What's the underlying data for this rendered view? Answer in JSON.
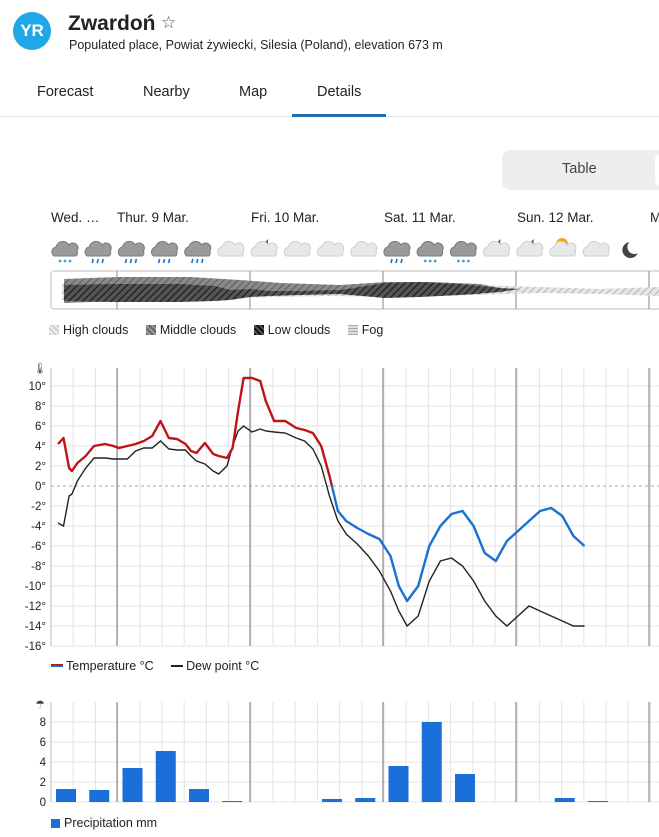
{
  "header": {
    "logo_text": "YR",
    "title": "Zwardoń",
    "star": "☆",
    "subtitle": "Populated place, Powiat żywiecki, Silesia (Poland), elevation 673 m"
  },
  "tabs": [
    {
      "label": "Forecast"
    },
    {
      "label": "Nearby"
    },
    {
      "label": "Map"
    },
    {
      "label": "Details",
      "active": true
    }
  ],
  "view_toggle": {
    "label": "Table"
  },
  "days": [
    "Wed. …",
    "Thur. 9 Mar.",
    "Fri. 10 Mar.",
    "Sat. 11 Mar.",
    "Sun. 12 Mar.",
    "M"
  ],
  "weather_icons": [
    "snow-cloud-icon",
    "rain-cloud-icon",
    "rain-cloud-icon",
    "rain-cloud-icon",
    "rain-cloud-icon",
    "cloud-icon",
    "moon-cloud-icon",
    "cloud-icon",
    "cloud-icon",
    "cloud-icon",
    "rain-cloud-icon",
    "snow-cloud-icon",
    "snow-cloud-icon",
    "moon-cloud-icon",
    "moon-cloud-icon",
    "sun-cloud-icon",
    "cloud-icon",
    "moon-icon"
  ],
  "cloud_legend": {
    "high": "High clouds",
    "middle": "Middle clouds",
    "low": "Low clouds",
    "fog": "Fog"
  },
  "temp_legend": {
    "temperature": "Temperature °C",
    "dew_point": "Dew point °C"
  },
  "precip_legend": {
    "label": "Precipitation mm"
  },
  "colors": {
    "temp_warm": "#c0141a",
    "temp_cold": "#1a72d0",
    "dew": "#222222",
    "precip": "#1a6fd8",
    "accent": "#1f6fb5",
    "logo": "#1fa7e6"
  },
  "chart_data": [
    {
      "type": "line",
      "title": "",
      "ylabel": "°C",
      "ylim": [
        -16,
        11
      ],
      "yticks": [
        "10°",
        "8°",
        "6°",
        "4°",
        "2°",
        "0°",
        "-2°",
        "-4°",
        "-6°",
        "-8°",
        "-10°",
        "-12°",
        "-14°",
        "-16°"
      ],
      "x_unit": "hours from start of chart",
      "series": [
        {
          "name": "Temperature °C",
          "x": [
            0,
            2,
            4,
            5,
            7,
            10,
            13,
            17,
            20,
            22,
            25,
            28,
            31,
            34,
            37,
            40,
            43,
            46,
            48,
            50,
            53,
            56,
            58,
            61,
            63,
            65,
            67,
            70,
            73,
            75,
            78,
            82,
            86,
            89,
            92,
            95,
            98,
            101,
            104,
            108,
            112,
            116,
            120,
            123,
            126,
            130,
            134,
            138,
            142,
            146,
            150,
            154,
            158,
            162,
            166,
            170,
            174,
            178,
            182,
            186,
            190
          ],
          "y": [
            4.2,
            4.8,
            1.8,
            1.5,
            2.3,
            3.0,
            4.0,
            4.2,
            4.0,
            3.8,
            4.0,
            4.2,
            4.5,
            5.0,
            6.5,
            4.8,
            4.7,
            4.2,
            3.5,
            3.3,
            4.3,
            3.2,
            3.0,
            2.8,
            3.8,
            7.5,
            10.8,
            10.8,
            10.5,
            8.5,
            6.5,
            6.5,
            5.8,
            5.6,
            5.3,
            4.0,
            1.0,
            -2.5,
            -3.5,
            -4.2,
            -4.8,
            -5.3,
            -7.0,
            -10.0,
            -11.5,
            -10.0,
            -6.0,
            -4.0,
            -2.8,
            -2.5,
            -4.0,
            -6.7,
            -7.5,
            -5.5,
            -4.5,
            -3.5,
            -2.5,
            -2.2,
            -3.0,
            -5.0,
            -6.0
          ]
        },
        {
          "name": "Dew point °C",
          "x": [
            0,
            2,
            4,
            5,
            7,
            10,
            13,
            17,
            20,
            22,
            25,
            28,
            31,
            34,
            37,
            40,
            43,
            46,
            48,
            50,
            53,
            56,
            58,
            61,
            63,
            65,
            67,
            70,
            73,
            75,
            78,
            82,
            86,
            89,
            92,
            95,
            98,
            101,
            104,
            108,
            112,
            116,
            120,
            123,
            126,
            130,
            134,
            138,
            142,
            146,
            150,
            154,
            158,
            162,
            166,
            170,
            174,
            178,
            182,
            186,
            190
          ],
          "y": [
            -3.7,
            -4.0,
            -1.0,
            -0.8,
            0.5,
            1.8,
            2.8,
            2.8,
            2.7,
            2.7,
            2.7,
            3.5,
            3.8,
            3.8,
            4.5,
            3.7,
            3.6,
            3.6,
            3.0,
            2.5,
            2.2,
            1.5,
            1.2,
            2.0,
            4.0,
            5.5,
            6.0,
            5.4,
            5.7,
            5.5,
            5.4,
            5.3,
            4.8,
            4.5,
            3.7,
            2.0,
            -1.0,
            -3.5,
            -4.8,
            -5.8,
            -7.0,
            -8.5,
            -10.5,
            -12.5,
            -14.0,
            -13.0,
            -9.5,
            -7.5,
            -7.2,
            -8.0,
            -9.5,
            -11.5,
            -13.0,
            -14.0,
            -13.0,
            -12.0,
            -12.5,
            -13.0,
            -13.5,
            -14.0,
            -14.0
          ]
        }
      ],
      "grid": true
    },
    {
      "type": "bar",
      "title": "",
      "ylabel": "mm",
      "ylim": [
        0,
        9
      ],
      "yticks": [
        "8",
        "6",
        "4",
        "2",
        "0"
      ],
      "categories": [
        "1",
        "2",
        "3",
        "4",
        "5",
        "6",
        "7",
        "8",
        "9",
        "10",
        "11",
        "12",
        "13",
        "14",
        "15",
        "16",
        "17"
      ],
      "values": [
        1.3,
        1.2,
        3.4,
        5.1,
        1.3,
        0.1,
        0.0,
        0.0,
        0.3,
        0.4,
        3.6,
        8.0,
        2.8,
        0.0,
        0.0,
        0.4,
        0.1
      ],
      "series": [
        {
          "name": "Precipitation mm"
        }
      ],
      "grid": true
    }
  ]
}
